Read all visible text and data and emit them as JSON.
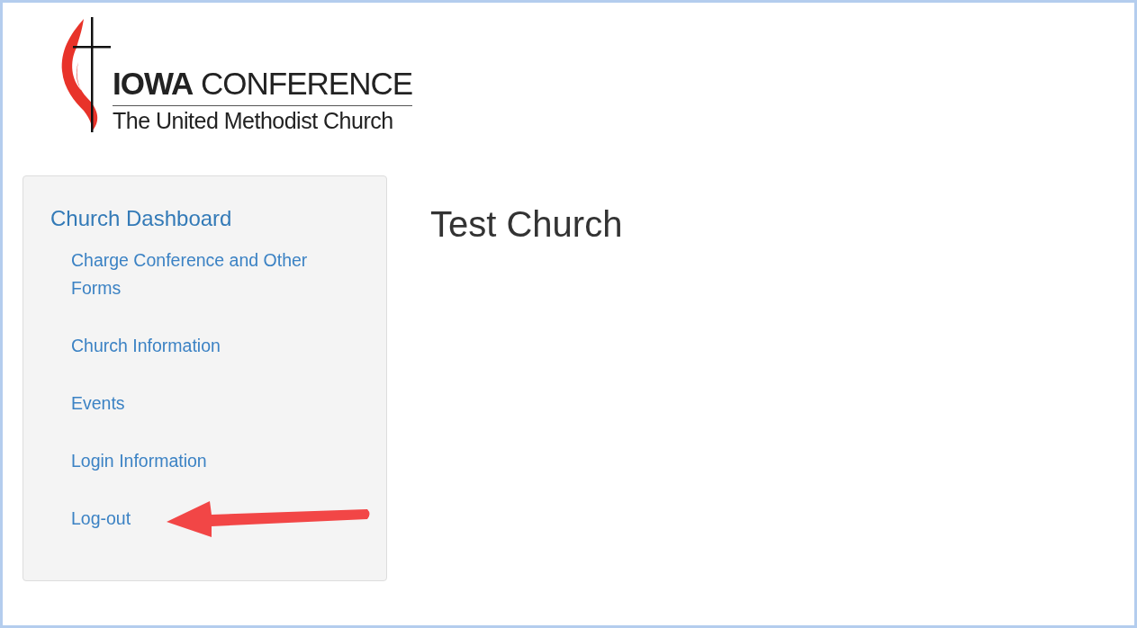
{
  "logo": {
    "title": "**IOWA** CONFERENCE",
    "subtitle": "The United Methodist Church"
  },
  "sidebar": {
    "heading": "Church Dashboard",
    "items": [
      {
        "label": "Charge Conference and Other Forms"
      },
      {
        "label": "Church Information"
      },
      {
        "label": "Events"
      },
      {
        "label": "Login Information"
      },
      {
        "label": "Log-out",
        "annotated": true
      }
    ]
  },
  "main": {
    "title": "Test Church"
  }
}
